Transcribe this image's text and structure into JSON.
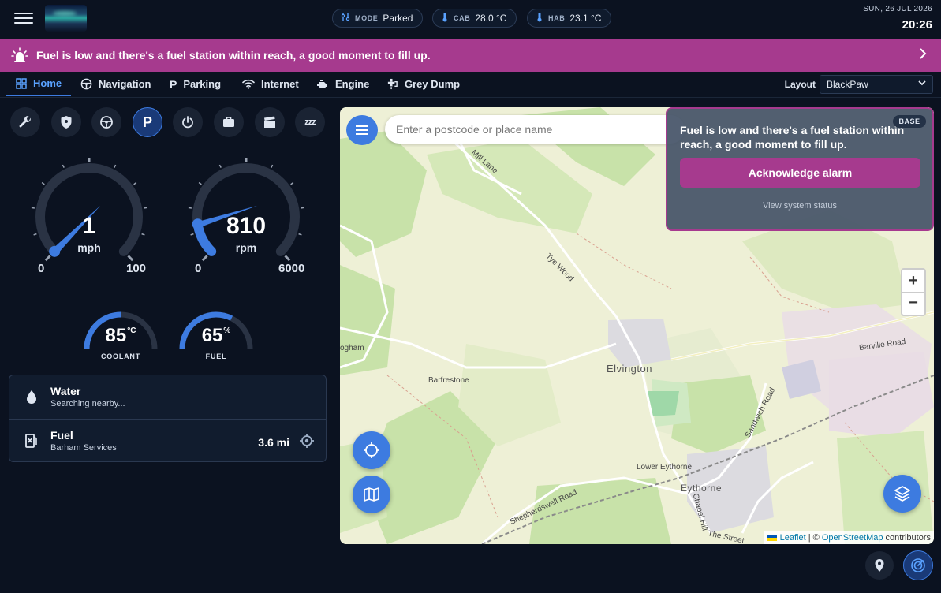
{
  "header": {
    "mode_label": "MODE",
    "mode_value": "Parked",
    "cab_label": "CAB",
    "cab_value": "28.0 °C",
    "hab_label": "HAB",
    "hab_value": "23.1 °C",
    "date": "SUN, 26 JUL 2026",
    "time": "20:26"
  },
  "banner": {
    "message": "Fuel is low and there's a fuel station within reach, a good moment to fill up.",
    "color": "#a63a8e"
  },
  "tabs": [
    {
      "label": "Home",
      "icon": "grid-icon",
      "active": true
    },
    {
      "label": "Navigation",
      "icon": "steering-wheel-icon"
    },
    {
      "label": "Parking",
      "icon": "parking-icon"
    },
    {
      "label": "Internet",
      "icon": "wifi-icon"
    },
    {
      "label": "Engine",
      "icon": "engine-icon"
    },
    {
      "label": "Grey Dump",
      "icon": "tap-icon"
    }
  ],
  "layout": {
    "label": "Layout",
    "selected": "BlackPaw"
  },
  "modes": [
    {
      "icon": "wrench-icon"
    },
    {
      "icon": "shield-icon"
    },
    {
      "icon": "steering-wheel-icon"
    },
    {
      "icon": "parking-icon",
      "label": "P",
      "active": true
    },
    {
      "icon": "power-icon"
    },
    {
      "icon": "briefcase-icon"
    },
    {
      "icon": "clapperboard-icon"
    },
    {
      "icon": "sleep-icon",
      "label": "zzz"
    }
  ],
  "gauges": {
    "speed": {
      "value": "1",
      "unit": "mph",
      "min": "0",
      "max": "100",
      "fraction": 0.01
    },
    "rpm": {
      "value": "810",
      "unit": "rpm",
      "min": "0",
      "max": "6000",
      "fraction": 0.135
    },
    "coolant": {
      "value": "85",
      "unit": "°C",
      "caption": "COOLANT",
      "fraction": 0.5
    },
    "fuel": {
      "value": "65",
      "unit": "%",
      "caption": "FUEL",
      "fraction": 0.65
    }
  },
  "services": [
    {
      "name": "Water",
      "status": "Searching nearby...",
      "icon": "water-drop-icon"
    },
    {
      "name": "Fuel",
      "status": "Barham Services",
      "distance": "3.6 mi",
      "icon": "fuel-pump-icon"
    }
  ],
  "map": {
    "search_placeholder": "Enter a postcode or place name",
    "alarm_message": "Fuel is low and there's a fuel station within reach, a good moment to fill up.",
    "acknowledge_label": "Acknowledge alarm",
    "view_status_label": "View system status",
    "base_badge": "BASE",
    "zoom_in": "+",
    "zoom_out": "−",
    "attribution_leaflet": "Leaflet",
    "attribution_sep": " | © ",
    "attribution_osm": "OpenStreetMap",
    "attribution_suffix": " contributors",
    "labels": {
      "elvington": "Elvington",
      "barfrestone": "Barfrestone",
      "lower_eythorne": "Lower Eythorne",
      "eythorne": "Eythorne",
      "tye_wood": "Tye Wood",
      "mill_lane": "Mill Lane",
      "barville_road": "Barville Road",
      "sandwich_road": "Sandwich Road",
      "shepherdswell_road": "Shepherdswell Road",
      "chapel_hill": "Chapel Hill",
      "the_street": "The Street",
      "ogham": "ogham"
    }
  },
  "colors": {
    "accent": "#3d7be0",
    "alert": "#a63a8e",
    "background": "#0b1220"
  }
}
